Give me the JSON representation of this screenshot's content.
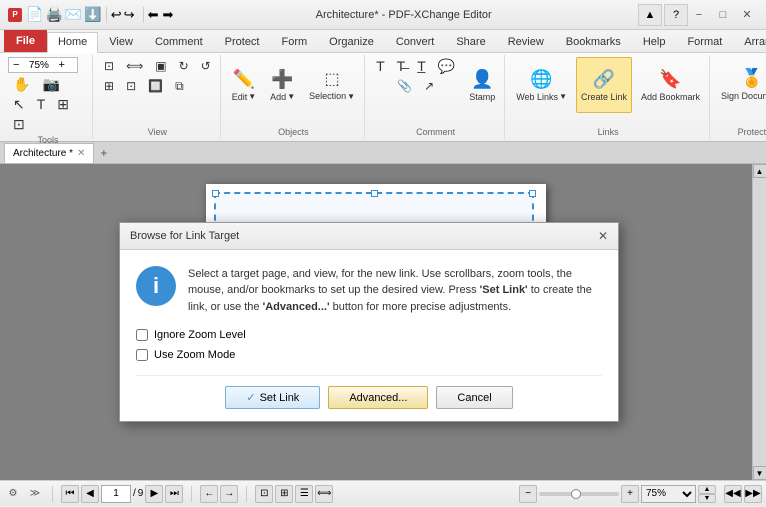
{
  "titleBar": {
    "title": "Architecture* - PDF-XChange Editor",
    "minimize": "−",
    "maximize": "□",
    "close": "✕"
  },
  "menuBar": {
    "file": "File",
    "items": [
      "Home",
      "View",
      "Comment",
      "Protect",
      "Form",
      "Organize",
      "Convert",
      "Share",
      "Review",
      "Bookmarks",
      "Help",
      "Format",
      "Arrange"
    ]
  },
  "ribbon": {
    "groups": {
      "tools": "Tools",
      "view": "View",
      "objects": "Objects",
      "comment": "Comment",
      "links": "Links",
      "protect": "Protect"
    },
    "zoom": "75%",
    "edit_label": "Edit",
    "add_label": "Add",
    "selection_label": "Selection",
    "stamp_label": "Stamp",
    "web_links_label": "Web Links",
    "create_link_label": "Create Link",
    "add_bookmark_label": "Add Bookmark",
    "sign_document_label": "Sign Document"
  },
  "tabs": {
    "architecture": "Architecture *",
    "close_char": "✕",
    "add_char": "+"
  },
  "statusBar": {
    "page_current": "1",
    "page_total": "9",
    "zoom": "75%"
  },
  "dialog": {
    "title": "Browse for Link Target",
    "info_text_1": "Select a target page, and view, for the new link. Use scrollbars, zoom tools, the mouse, and/or bookmarks to set up the desired view. Press ",
    "info_bold_1": "'Set Link'",
    "info_text_2": " to create the link, or use the ",
    "info_bold_2": "'Advanced...'",
    "info_text_3": " button for more precise adjustments.",
    "checkbox1": "Ignore Zoom Level",
    "checkbox2": "Use Zoom Mode",
    "set_link": "Set Link",
    "advanced": "Advanced...",
    "cancel": "Cancel"
  },
  "icons": {
    "info": "i",
    "checkmark": "✓",
    "back": "←",
    "fwd": "→",
    "home": "⌂",
    "first_page": "⏮",
    "prev_page": "◀",
    "next_page": "▶",
    "last_page": "⏭",
    "zoom_in": "+",
    "zoom_out": "−",
    "settings": "⚙",
    "up": "▲",
    "down": "▼"
  }
}
